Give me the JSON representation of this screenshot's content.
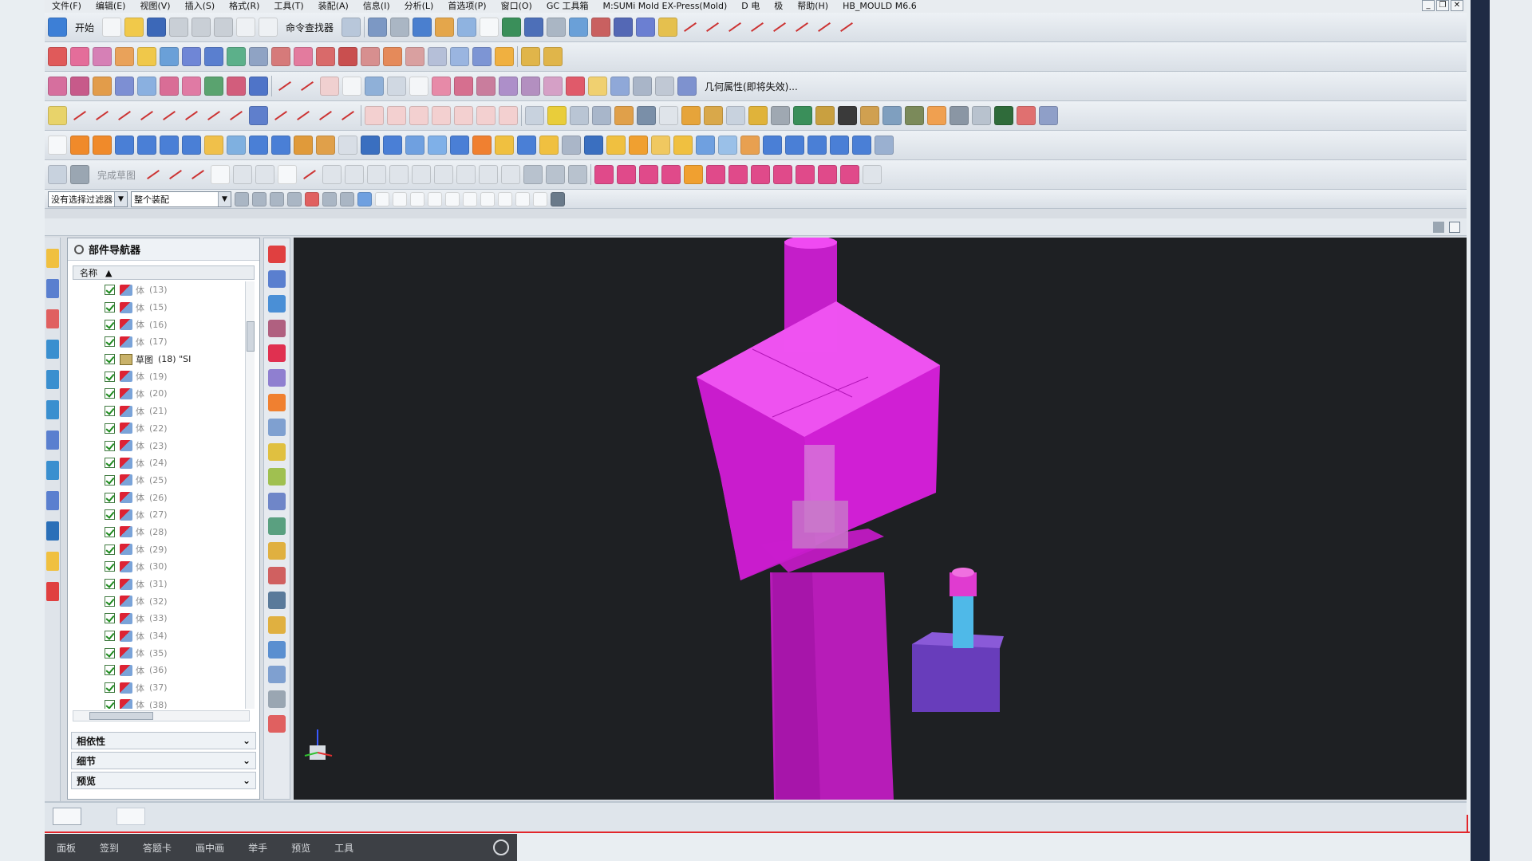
{
  "menu": {
    "items": [
      "文件(F)",
      "编辑(E)",
      "视图(V)",
      "插入(S)",
      "格式(R)",
      "工具(T)",
      "装配(A)",
      "信息(I)",
      "分析(L)",
      "首选项(P)",
      "窗口(O)",
      "GC 工具箱",
      "M:SUMi Mold EX-Press(Mold)",
      "D 电",
      "极",
      "帮助(H)",
      "HB_MOULD M6.6"
    ]
  },
  "toolbar": {
    "start_label": "开始",
    "cmd_finder_label": "命令查找器",
    "geom_prop_label": "几何属性(即将失效)...",
    "finish_sketch_label": "完成草图",
    "filter_label": "没有选择过滤器",
    "assembly_label": "整个装配"
  },
  "nav": {
    "title": "部件导航器",
    "col_name": "名称",
    "rows": [
      {
        "type": "body",
        "label": "体",
        "num": "(13)"
      },
      {
        "type": "body",
        "label": "体",
        "num": "(15)"
      },
      {
        "type": "body",
        "label": "体",
        "num": "(16)"
      },
      {
        "type": "body",
        "label": "体",
        "num": "(17)"
      },
      {
        "type": "sketch",
        "label": "草图",
        "num": "(18) \"SI"
      },
      {
        "type": "body",
        "label": "体",
        "num": "(19)"
      },
      {
        "type": "body",
        "label": "体",
        "num": "(20)"
      },
      {
        "type": "body",
        "label": "体",
        "num": "(21)"
      },
      {
        "type": "body",
        "label": "体",
        "num": "(22)"
      },
      {
        "type": "body",
        "label": "体",
        "num": "(23)"
      },
      {
        "type": "body",
        "label": "体",
        "num": "(24)"
      },
      {
        "type": "body",
        "label": "体",
        "num": "(25)"
      },
      {
        "type": "body",
        "label": "体",
        "num": "(26)"
      },
      {
        "type": "body",
        "label": "体",
        "num": "(27)"
      },
      {
        "type": "body",
        "label": "体",
        "num": "(28)"
      },
      {
        "type": "body",
        "label": "体",
        "num": "(29)"
      },
      {
        "type": "body",
        "label": "体",
        "num": "(30)"
      },
      {
        "type": "body",
        "label": "体",
        "num": "(31)"
      },
      {
        "type": "body",
        "label": "体",
        "num": "(32)"
      },
      {
        "type": "body",
        "label": "体",
        "num": "(33)"
      },
      {
        "type": "body",
        "label": "体",
        "num": "(34)"
      },
      {
        "type": "body",
        "label": "体",
        "num": "(35)"
      },
      {
        "type": "body",
        "label": "体",
        "num": "(36)"
      },
      {
        "type": "body",
        "label": "体",
        "num": "(37)"
      },
      {
        "type": "body",
        "label": "体",
        "num": "(38)"
      }
    ],
    "panels": [
      "相依性",
      "细节",
      "预览"
    ]
  },
  "taskbar": {
    "items": [
      "面板",
      "签到",
      "答题卡",
      "画中画",
      "举手",
      "预览",
      "工具"
    ]
  },
  "colors": {
    "part": "#e21ee6",
    "accent": "#e2262b",
    "bg": "#1e2023"
  }
}
